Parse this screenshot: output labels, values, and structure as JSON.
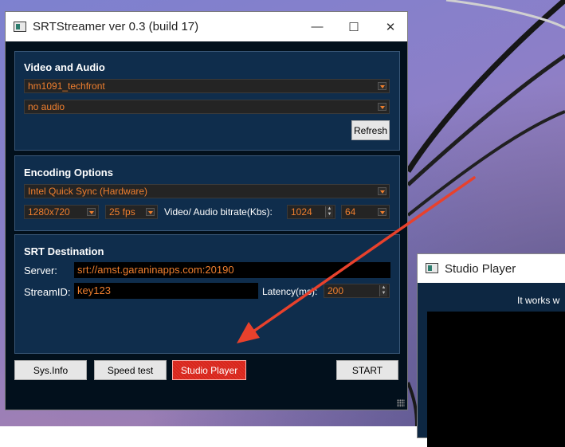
{
  "main_window": {
    "title": "SRTStreamer ver 0.3 (build 17)",
    "controls": {
      "minimize": "—",
      "maximize": "☐",
      "close": "✕"
    }
  },
  "video_audio": {
    "title": "Video and Audio",
    "video_source": "hm1091_techfront",
    "audio_source": "no audio",
    "refresh_label": "Refresh"
  },
  "encoding": {
    "title": "Encoding Options",
    "encoder": "Intel Quick Sync (Hardware)",
    "resolution": "1280x720",
    "fps": "25 fps",
    "bitrate_label": "Video/ Audio bitrate(Kbs):",
    "video_bitrate": "1024",
    "audio_bitrate": "64"
  },
  "srt": {
    "title": "SRT Destination",
    "server_label": "Server:",
    "server_value": "srt://amst.garaninapps.com:20190",
    "streamid_label": "StreamID:",
    "streamid_value": "key123",
    "latency_label": "Latency(ms):",
    "latency_value": "200"
  },
  "buttons": {
    "sysinfo": "Sys.Info",
    "speedtest": "Speed test",
    "studio_player": "Studio Player",
    "start": "START"
  },
  "player_window": {
    "title": "Studio Player",
    "message": "It works w"
  },
  "colors": {
    "accent_orange": "#f07f2e",
    "panel_blue": "#0f2d4c",
    "annotation_red": "#e8412c"
  }
}
